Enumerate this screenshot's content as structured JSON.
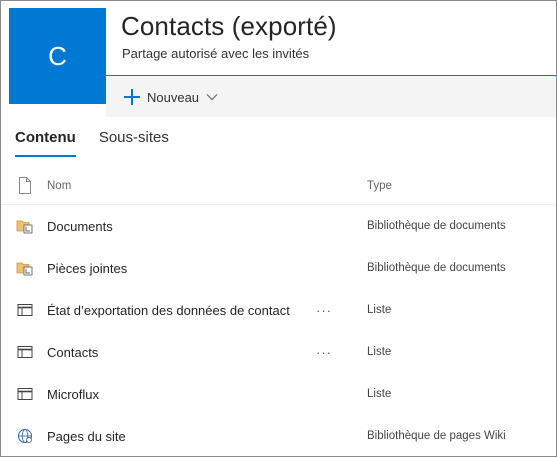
{
  "site": {
    "logo_letter": "C",
    "title": "Contacts (exporté)",
    "subtitle": "Partage autorisé avec les invités",
    "accent_color": "#0078d4"
  },
  "command_bar": {
    "new_label": "Nouveau"
  },
  "tabs": [
    {
      "label": "Contenu",
      "selected": true
    },
    {
      "label": "Sous-sites",
      "selected": false
    }
  ],
  "list": {
    "columns": {
      "name": "Nom",
      "type": "Type"
    },
    "rows": [
      {
        "name": "Documents",
        "type": "Bibliothèque de documents",
        "icon": "document-library-icon",
        "more": ""
      },
      {
        "name": "Pièces jointes",
        "type": "Bibliothèque de documents",
        "icon": "document-library-icon",
        "more": ""
      },
      {
        "name": "État d’exportation des données de contact",
        "type": "Liste",
        "icon": "list-icon",
        "more": "···"
      },
      {
        "name": "Contacts",
        "type": "Liste",
        "icon": "list-icon",
        "more": "···"
      },
      {
        "name": "Microflux",
        "type": "Liste",
        "icon": "list-icon",
        "more": ""
      },
      {
        "name": "Pages du site",
        "type": "Bibliothèque de pages Wiki",
        "icon": "wiki-library-icon",
        "more": ""
      }
    ]
  }
}
